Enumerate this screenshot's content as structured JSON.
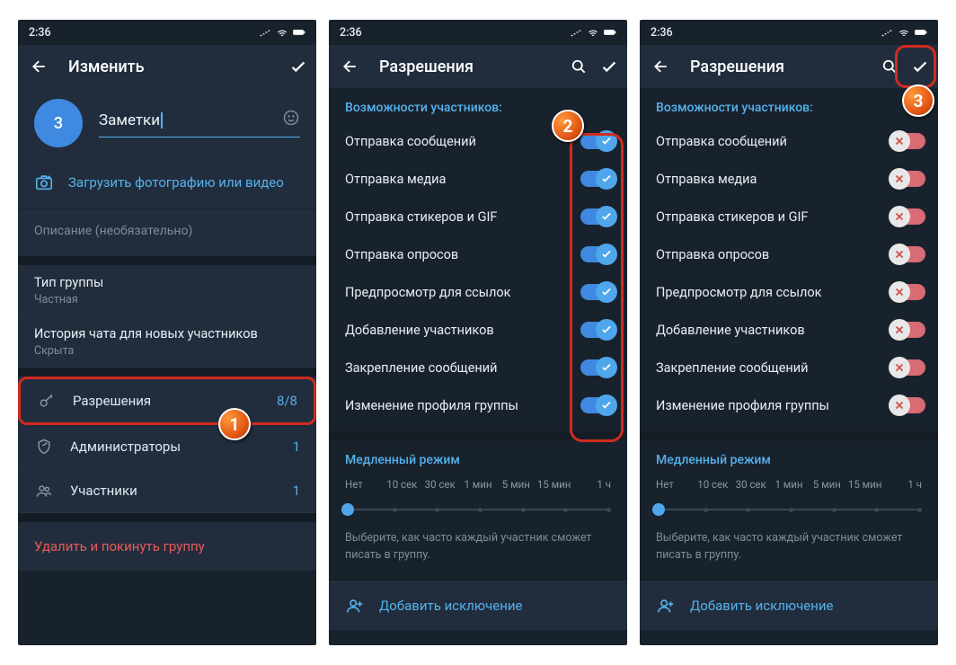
{
  "status": {
    "time": "2:36"
  },
  "screen1": {
    "header_title": "Изменить",
    "avatar_count": "3",
    "group_name": "Заметки",
    "upload_label": "Загрузить фотографию или видео",
    "description_placeholder": "Описание (необязательно)",
    "group_type": {
      "label": "Тип группы",
      "value": "Частная"
    },
    "history": {
      "label": "История чата для новых участников",
      "value": "Скрыта"
    },
    "permissions": {
      "label": "Разрешения",
      "value": "8/8"
    },
    "admins": {
      "label": "Администраторы",
      "value": "1"
    },
    "members": {
      "label": "Участники",
      "value": "1"
    },
    "delete_label": "Удалить и покинуть группу"
  },
  "screen2": {
    "header_title": "Разрешения",
    "section_title": "Возможности участников:",
    "perms": [
      "Отправка сообщений",
      "Отправка медиа",
      "Отправка стикеров и GIF",
      "Отправка опросов",
      "Предпросмотр для ссылок",
      "Добавление участников",
      "Закрепление сообщений",
      "Изменение профиля группы"
    ],
    "slow_title": "Медленный режим",
    "slow_labels": [
      "Нет",
      "10 сек",
      "30 сек",
      "1 мин",
      "5 мин",
      "15 мин",
      "1 ч"
    ],
    "slow_hint": "Выберите, как часто каждый участник сможет писать в группу.",
    "add_exception": "Добавить исключение"
  },
  "badges": {
    "b1": "1",
    "b2": "2",
    "b3": "3"
  }
}
